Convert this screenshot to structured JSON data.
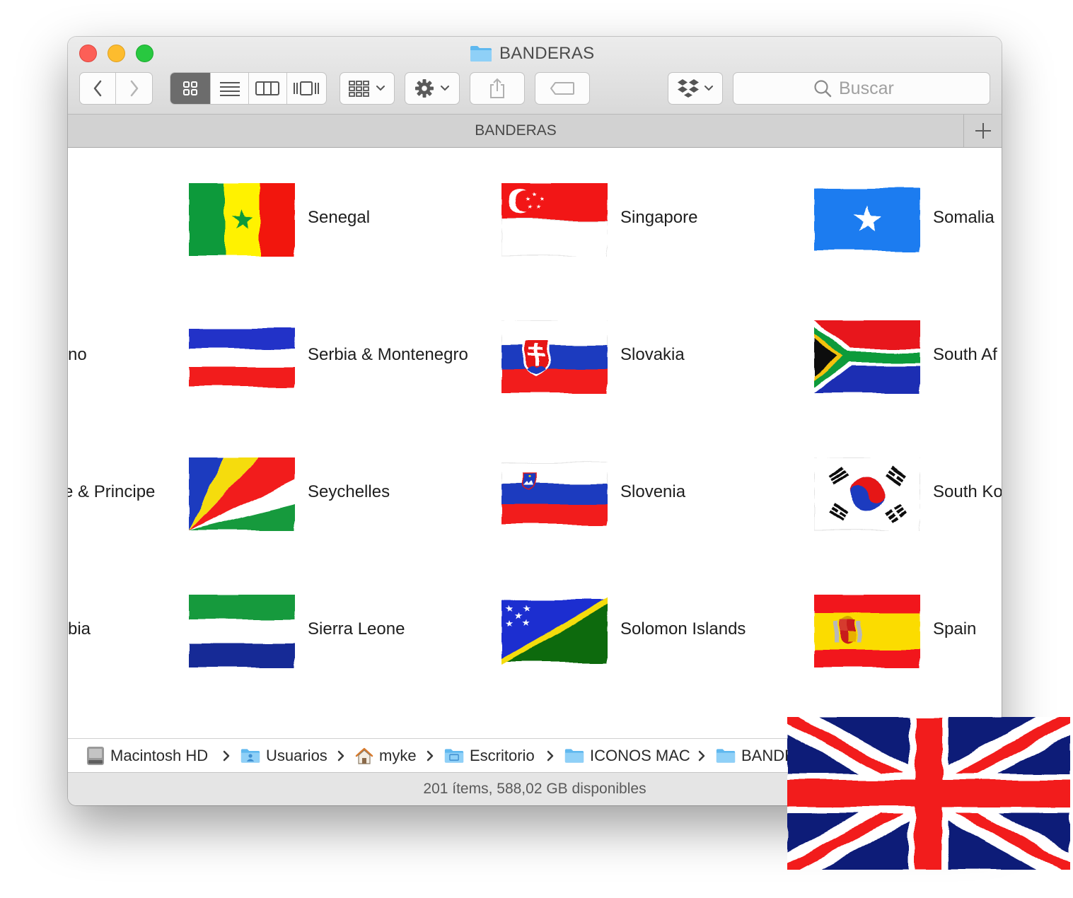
{
  "window": {
    "title": "BANDERAS"
  },
  "search": {
    "placeholder": "Buscar"
  },
  "path_tab": {
    "title": "BANDERAS"
  },
  "cut_labels": [
    "no",
    "e & Principe",
    "bia"
  ],
  "items": [
    {
      "name": "Senegal"
    },
    {
      "name": "Singapore"
    },
    {
      "name": "Somalia"
    },
    {
      "name": "Serbia & Montenegro"
    },
    {
      "name": "Slovakia"
    },
    {
      "name": "South Af"
    },
    {
      "name": "Seychelles"
    },
    {
      "name": "Slovenia"
    },
    {
      "name": "South Ko"
    },
    {
      "name": "Sierra Leone"
    },
    {
      "name": "Solomon Islands"
    },
    {
      "name": "Spain"
    }
  ],
  "breadcrumb": [
    "Macintosh HD",
    "Usuarios",
    "myke",
    "Escritorio",
    "ICONOS MAC",
    "BANDE"
  ],
  "status": {
    "text": "201 ítems, 588,02 GB disponibles"
  }
}
